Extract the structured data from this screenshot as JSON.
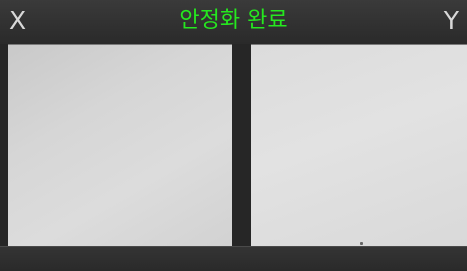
{
  "header": {
    "left_label": "X",
    "status_text": "안정화 완료",
    "right_label": "Y"
  },
  "colors": {
    "status_text": "#25e81f",
    "axis_label": "#d8d8d8",
    "background": "#262626"
  }
}
